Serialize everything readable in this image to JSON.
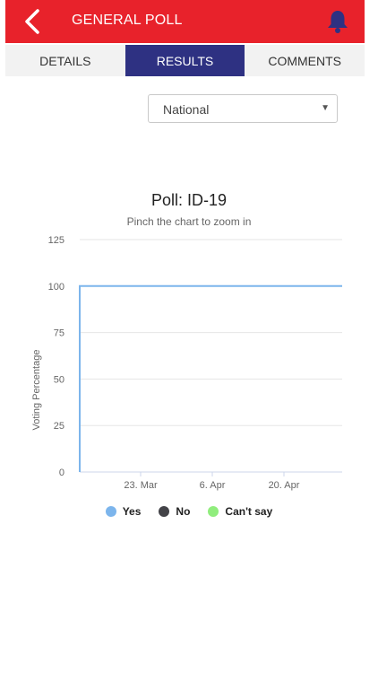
{
  "header": {
    "title": "GENERAL POLL"
  },
  "tabs": [
    {
      "label": "DETAILS",
      "active": false
    },
    {
      "label": "RESULTS",
      "active": true
    },
    {
      "label": "COMMENTS",
      "active": false
    }
  ],
  "region_select": {
    "value": "National"
  },
  "colors": {
    "appbar": "#e8222b",
    "active_tab": "#2e3182",
    "bell": "#2e3182"
  },
  "chart_data": {
    "type": "line",
    "title": "Poll:  ID-19",
    "subtitle": "Pinch the chart to zoom in",
    "ylabel": "Voting Percentage",
    "xlabel": "",
    "ylim": [
      0,
      125
    ],
    "yticks": [
      0,
      25,
      50,
      75,
      100,
      125
    ],
    "xticks": [
      "23. Mar",
      "6. Apr",
      "20. Apr"
    ],
    "grid": true,
    "legend_position": "bottom",
    "series": [
      {
        "name": "Yes",
        "color": "#7cb5ec",
        "values": [
          100,
          100
        ]
      },
      {
        "name": "No",
        "color": "#434348",
        "values": []
      },
      {
        "name": "Can't say",
        "color": "#90ed7d",
        "values": []
      }
    ]
  }
}
